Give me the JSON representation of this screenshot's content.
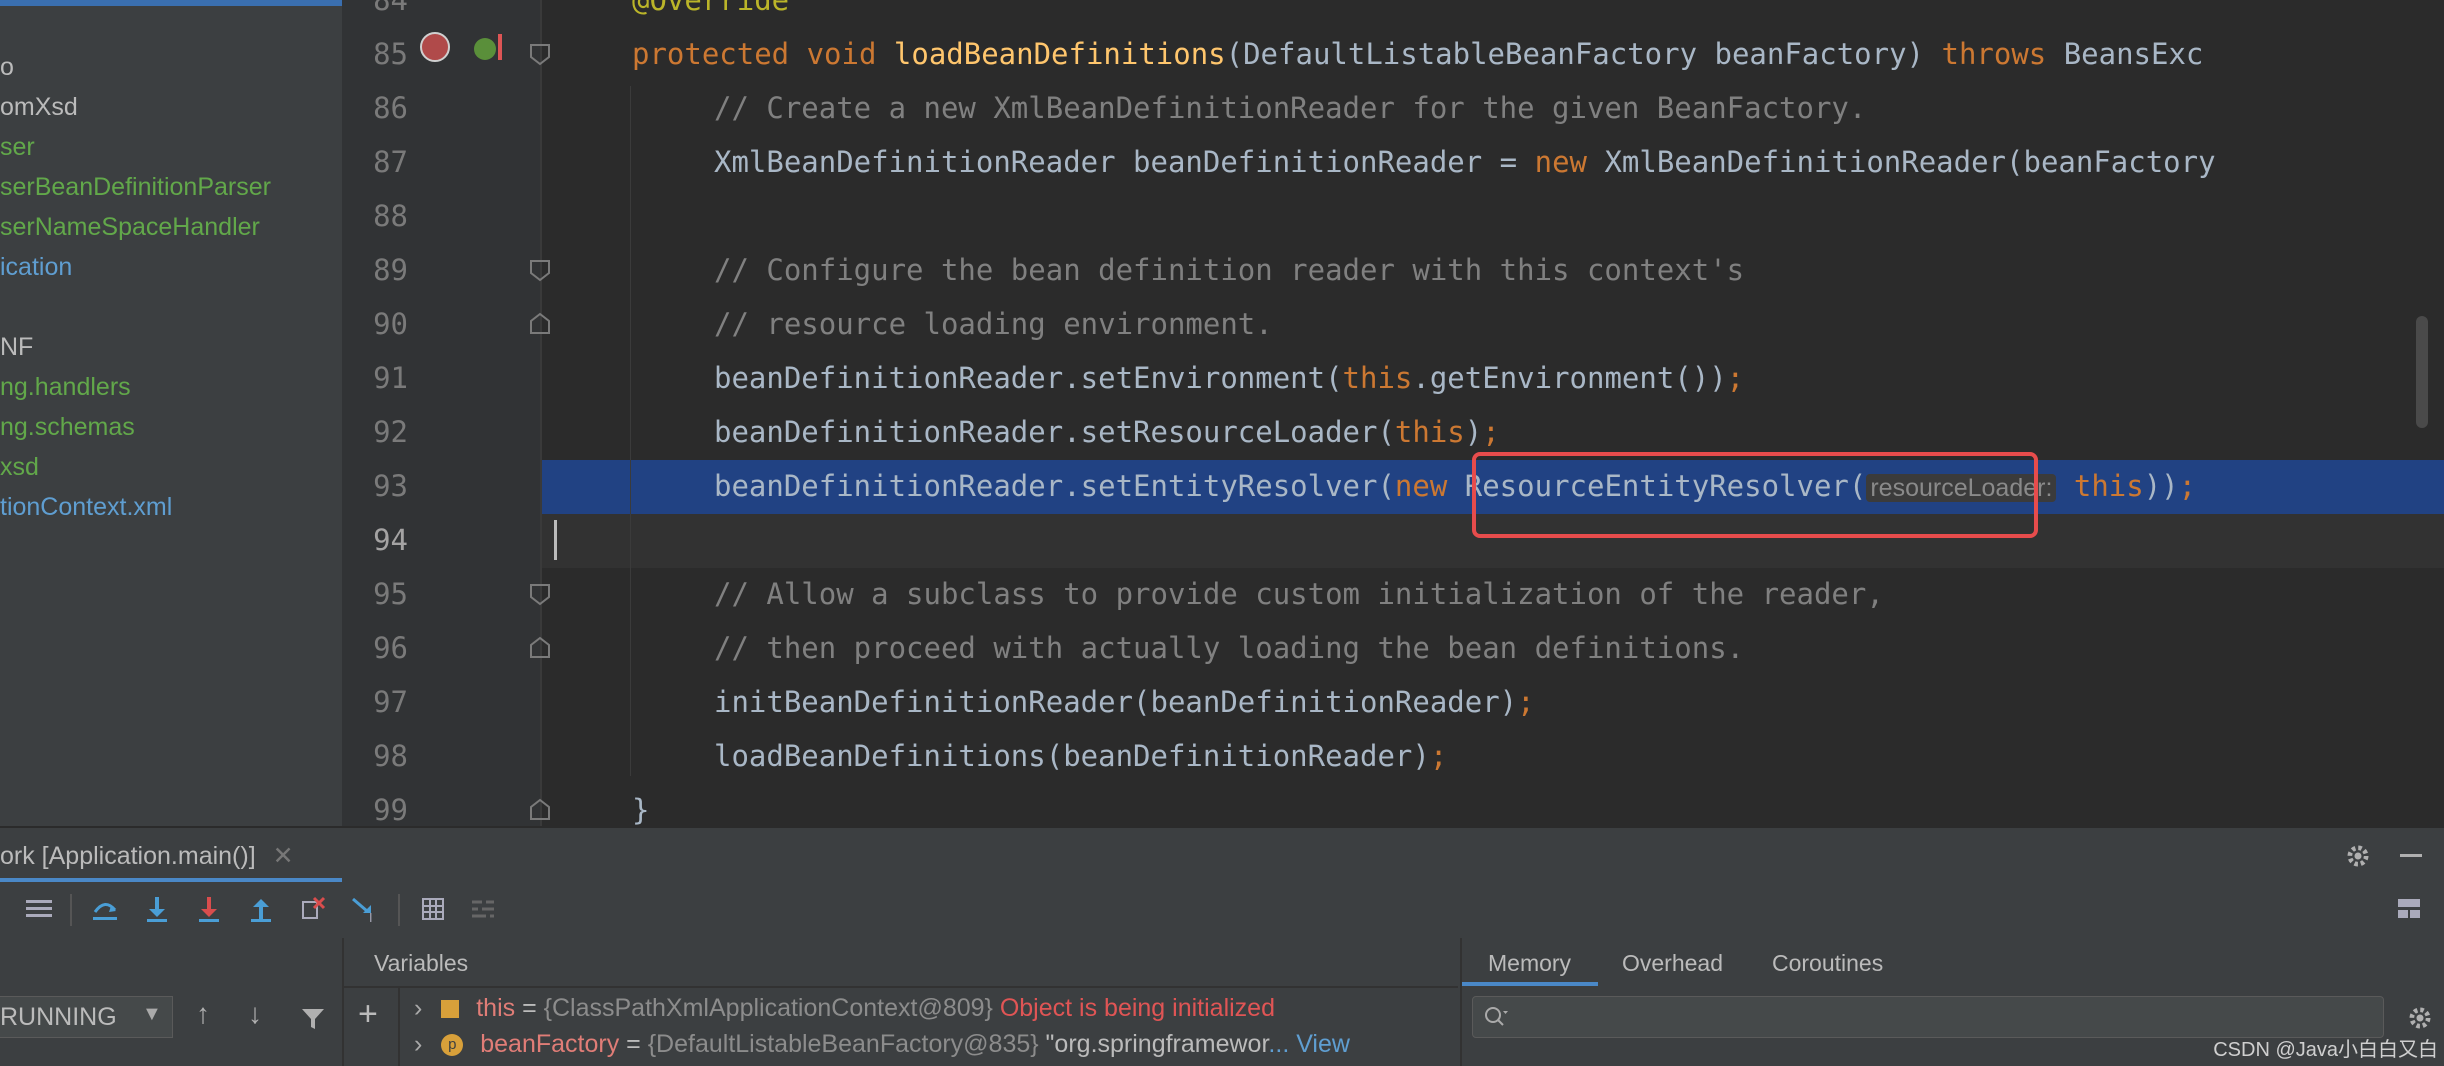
{
  "project_tree": {
    "items": [
      {
        "label": "o",
        "color": "#bbbbbb"
      },
      {
        "label": "omXsd",
        "color": "#bbbbbb"
      },
      {
        "label": "ser",
        "color": "#62a84a"
      },
      {
        "label": "serBeanDefinitionParser",
        "color": "#62a84a"
      },
      {
        "label": "serNameSpaceHandler",
        "color": "#62a84a"
      },
      {
        "label": "ication",
        "color": "#5f9ed1"
      },
      {
        "label": "NF",
        "color": "#bbbbbb"
      },
      {
        "label": "ng.handlers",
        "color": "#62a84a"
      },
      {
        "label": "ng.schemas",
        "color": "#62a84a"
      },
      {
        "label": "xsd",
        "color": "#62a84a"
      },
      {
        "label": "tionContext.xml",
        "color": "#5f9ed1"
      }
    ]
  },
  "editor": {
    "line_numbers": [
      "84",
      "85",
      "86",
      "87",
      "88",
      "89",
      "90",
      "91",
      "92",
      "93",
      "94",
      "95",
      "96",
      "97",
      "98",
      "99"
    ],
    "lines": {
      "l84": "@Override",
      "l85_kw1": "protected void ",
      "l85_fn": "loadBeanDefinitions",
      "l85_rest1": "(DefaultListableBeanFactory beanFactory) ",
      "l85_kw2": "throws ",
      "l85_rest2": "BeansExc",
      "l86": "// Create a new XmlBeanDefinitionReader for the given BeanFactory.",
      "l87_a": "XmlBeanDefinitionReader beanDefinitionReader = ",
      "l87_kw": "new ",
      "l87_b": "XmlBeanDefinitionReader(beanFactory",
      "l89": "// Configure the bean definition reader with this context's",
      "l90": "// resource loading environment.",
      "l91_a": "beanDefinitionReader.setEnvironment(",
      "l91_kw": "this",
      "l91_b": ".getEnvironment())",
      "l91_semi": ";",
      "l92_a": "beanDefinitionReader.setResourceLoader(",
      "l92_kw": "this",
      "l92_b": ")",
      "l92_semi": ";",
      "l93_a": "beanDefinitionReader.setEntityResolver(",
      "l93_kw": "new ",
      "l93_b": "ResourceEntityResolver(",
      "l93_hint": "resourceLoader:",
      "l93_kw2": "this",
      "l93_c": "))",
      "l93_semi": ";",
      "l95": "// Allow a subclass to provide custom initialization of the reader,",
      "l96": "// then proceed with actually loading the bean definitions.",
      "l97_a": "initBeanDefinitionReader(beanDefinitionReader)",
      "l97_semi": ";",
      "l98_a": "loadBeanDefinitions(beanDefinitionReader)",
      "l98_semi": ";",
      "l99": "}"
    }
  },
  "debug": {
    "session_tab": "ork [Application.main()]",
    "thread_state": "RUNNING",
    "variables_header": "Variables",
    "vars": [
      {
        "name": "this",
        "eq": " = ",
        "value": "{ClassPathXmlApplicationContext@809}",
        "extra": " Object is being initialized"
      },
      {
        "name": "beanFactory",
        "eq": " = ",
        "value": "{DefaultListableBeanFactory@835}",
        "extra": " \"org.springframewor",
        "link": "... View"
      }
    ],
    "right_tabs": [
      "Memory",
      "Overhead",
      "Coroutines"
    ]
  },
  "watermark": "CSDN @Java小白白又白",
  "colors": {
    "keyword": "#cc7832",
    "function": "#ffc66d",
    "comment": "#808080",
    "selection": "#214283",
    "highlight_box": "#e74c4c"
  }
}
